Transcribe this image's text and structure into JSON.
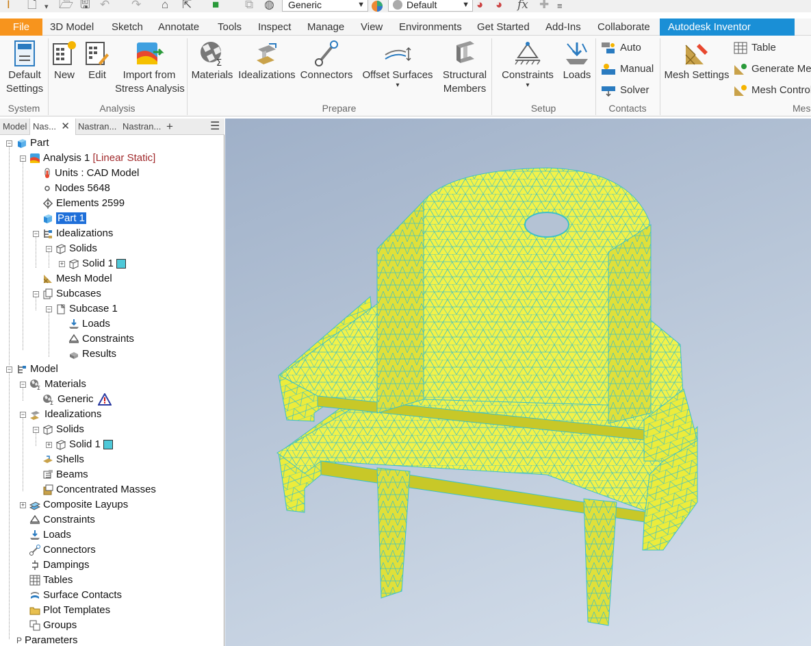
{
  "quick_access": {
    "material_select": "Generic",
    "appearance_select": "Default",
    "icons": [
      "inventor-logo-icon",
      "new-icon",
      "open-icon",
      "save-icon",
      "undo-icon",
      "redo-icon",
      "home-icon",
      "select-icon",
      "color-icon",
      "material-ball-icon",
      "appearance-icon",
      "fx-icon",
      "plus-icon",
      "customize-icon"
    ]
  },
  "menu_tabs": [
    "File",
    "3D Model",
    "Sketch",
    "Annotate",
    "Tools",
    "Inspect",
    "Manage",
    "View",
    "Environments",
    "Get Started",
    "Add-Ins",
    "Collaborate",
    "Autodesk Inventor Nastran"
  ],
  "ribbon": {
    "system": {
      "group": "System",
      "default_settings": [
        "Default",
        "Settings"
      ]
    },
    "analysis": {
      "group": "Analysis",
      "new": "New",
      "edit": "Edit",
      "import": [
        "Import from",
        "Stress Analysis"
      ]
    },
    "prepare": {
      "group": "Prepare",
      "materials": "Materials",
      "idealizations": "Idealizations",
      "connectors": "Connectors",
      "offset_surfaces": "Offset Surfaces",
      "structural_members": [
        "Structural",
        "Members"
      ]
    },
    "setup": {
      "group": "Setup",
      "constraints": "Constraints",
      "loads": "Loads"
    },
    "contacts": {
      "group": "Contacts",
      "auto": "Auto",
      "manual": "Manual",
      "solver": "Solver"
    },
    "mesh": {
      "group": "Mes",
      "mesh_settings": "Mesh Settings",
      "table": "Table",
      "generate_mesh": "Generate Mes",
      "mesh_control": "Mesh Control"
    }
  },
  "browser": {
    "tabs": [
      "Model",
      "Nas...",
      "Nastran...",
      "Nastran..."
    ],
    "tree": {
      "part": "Part",
      "analysis": "Analysis 1",
      "analysis_type": "[Linear Static]",
      "units": "Units : CAD Model",
      "nodes": "Nodes 5648",
      "elements": "Elements 2599",
      "part1": "Part 1",
      "idealizations": "Idealizations",
      "solids": "Solids",
      "solid1": "Solid 1",
      "mesh_model": "Mesh Model",
      "subcases": "Subcases",
      "subcase1": "Subcase 1",
      "loads": "Loads",
      "constraints": "Constraints",
      "results": "Results",
      "model": "Model",
      "materials": "Materials",
      "generic": "Generic",
      "m_idealizations": "Idealizations",
      "m_solids": "Solids",
      "m_solid1": "Solid 1",
      "shells": "Shells",
      "beams": "Beams",
      "concentrated_masses": "Concentrated Masses",
      "composite_layups": "Composite Layups",
      "m_constraints": "Constraints",
      "m_loads": "Loads",
      "connectors": "Connectors",
      "dampings": "Dampings",
      "tables": "Tables",
      "surface_contacts": "Surface Contacts",
      "plot_templates": "Plot Templates",
      "groups": "Groups",
      "parameters": "Parameters"
    }
  },
  "colors": {
    "file_tab": "#f7941d",
    "active_tab": "#1a8fd6",
    "mesh_fill": "#f2f24a",
    "mesh_edges": "#3cc0c8",
    "selection": "#1e6fd9",
    "solid_swatch": "#4ec8d8"
  }
}
